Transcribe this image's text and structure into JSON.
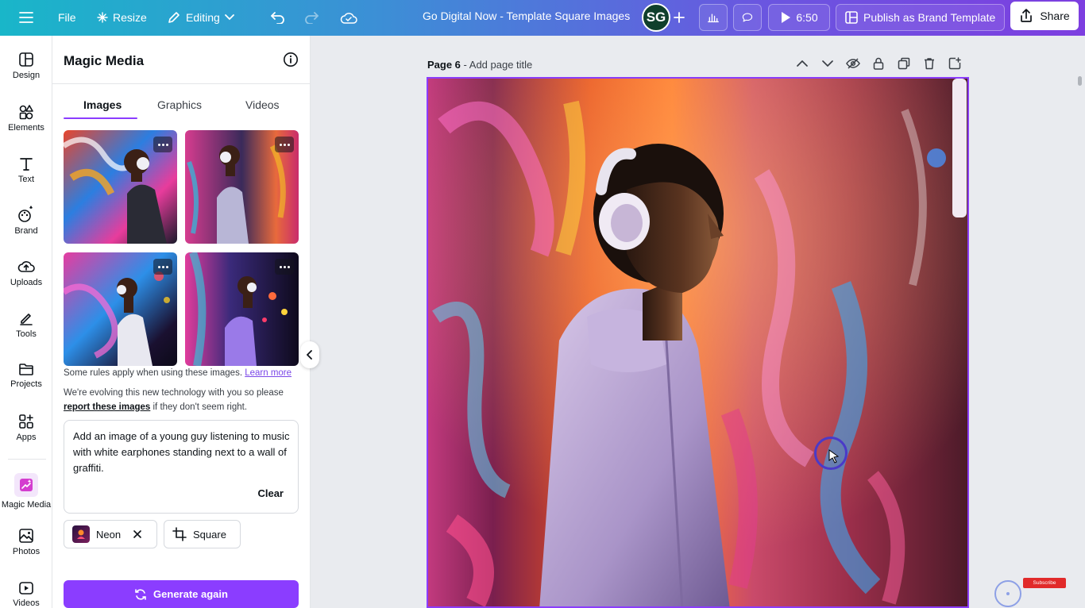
{
  "topbar": {
    "file_label": "File",
    "resize_label": "Resize",
    "editing_label": "Editing",
    "doc_title": "Go Digital Now - Template Square Images",
    "avatar_initials": "SG",
    "timer_label": "6:50",
    "publish_label": "Publish as Brand Template",
    "share_label": "Share"
  },
  "rail": {
    "items": [
      {
        "label": "Design",
        "icon": "design-icon"
      },
      {
        "label": "Elements",
        "icon": "elements-icon"
      },
      {
        "label": "Text",
        "icon": "text-icon"
      },
      {
        "label": "Brand",
        "icon": "brand-icon"
      },
      {
        "label": "Uploads",
        "icon": "uploads-icon"
      },
      {
        "label": "Tools",
        "icon": "tools-icon"
      },
      {
        "label": "Projects",
        "icon": "projects-icon"
      },
      {
        "label": "Apps",
        "icon": "apps-icon"
      },
      {
        "label": "Magic Media",
        "icon": "magic-media-icon"
      },
      {
        "label": "Photos",
        "icon": "photos-icon"
      },
      {
        "label": "Videos",
        "icon": "videos-icon"
      }
    ]
  },
  "panel": {
    "title": "Magic Media",
    "tabs": [
      {
        "label": "Images",
        "active": true
      },
      {
        "label": "Graphics",
        "active": false
      },
      {
        "label": "Videos",
        "active": false
      }
    ],
    "rules_text": "Some rules apply when using these images.",
    "learn_more": "Learn more",
    "evolving_text": "We're evolving this new technology with you so please",
    "report_link": "report these images",
    "report_suffix": "if they don't seem right.",
    "prompt": "Add an image of a young guy listening to music with white earphones standing next to a wall of graffiti.",
    "clear_label": "Clear",
    "style_chip": "Neon",
    "ratio_chip": "Square",
    "generate_label": "Generate again"
  },
  "canvas": {
    "page_label": "Page 6",
    "page_title_placeholder": "Add page title"
  },
  "overlay": {
    "subscribe": "Subscribe"
  },
  "colors": {
    "accent": "#8b3dff",
    "topbar_start": "#19b6c9",
    "topbar_end": "#7d3ee0"
  }
}
